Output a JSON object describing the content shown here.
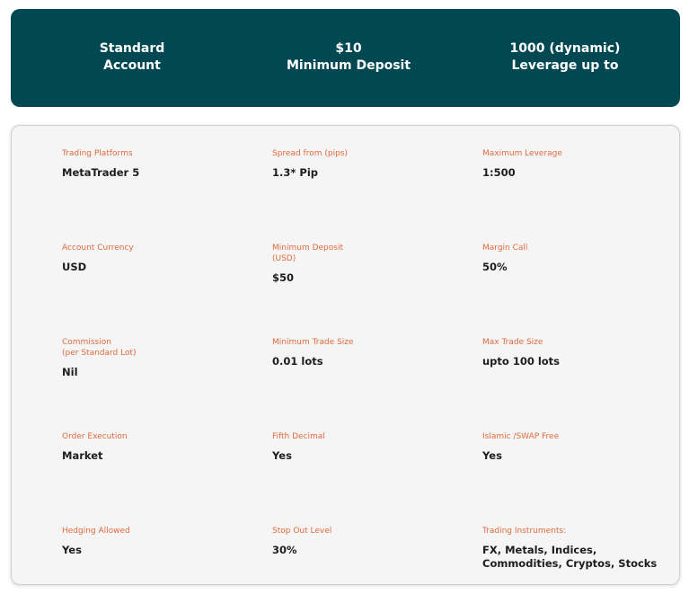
{
  "banner": {
    "account_type": {
      "line1": "Standard",
      "line2": "Account"
    },
    "deposit": {
      "line1": "$10",
      "line2": "Minimum Deposit"
    },
    "leverage": {
      "line1": "1000 (dynamic)",
      "line2": "Leverage up to"
    }
  },
  "specs": [
    {
      "label": "Trading Platforms",
      "value": "MetaTrader 5"
    },
    {
      "label": "Spread from (pips)",
      "value": "1.3* Pip"
    },
    {
      "label": "Maximum Leverage",
      "value": "1:500"
    },
    {
      "label": "Account Currency",
      "value": "USD"
    },
    {
      "label": "Minimum Deposit\n(USD)",
      "value": "$50"
    },
    {
      "label": "Margin Call",
      "value": "50%"
    },
    {
      "label": "Commission\n(per Standard Lot)",
      "value": "Nil"
    },
    {
      "label": "Minimum Trade Size",
      "value": "0.01 lots"
    },
    {
      "label": "Max Trade Size",
      "value": "upto 100 lots"
    },
    {
      "label": "Order Execution",
      "value": "Market"
    },
    {
      "label": "Fifth Decimal",
      "value": "Yes"
    },
    {
      "label": "Islamic /SWAP Free",
      "value": "Yes"
    },
    {
      "label": "Hedging Allowed",
      "value": "Yes"
    },
    {
      "label": "Stop Out Level",
      "value": "30%"
    },
    {
      "label": "Trading Instruments:",
      "value": "FX, Metals, Indices,\nCommodities, Cryptos, Stocks"
    }
  ],
  "colors": {
    "banner_bg": "#014853",
    "label_accent": "#e06a3c",
    "value_text": "#1d1d1d",
    "panel_bg": "#f5f5f5"
  }
}
